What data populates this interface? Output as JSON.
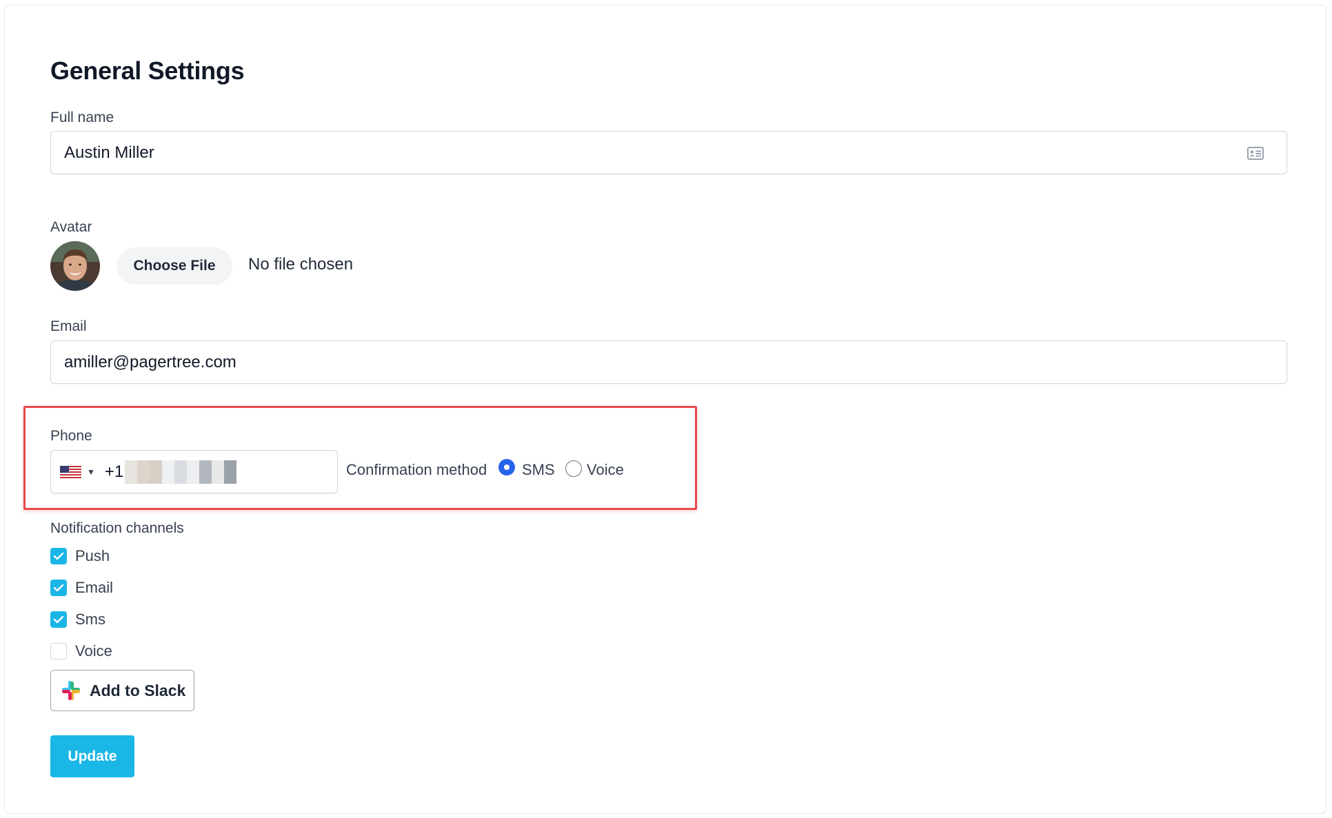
{
  "page": {
    "title": "General Settings"
  },
  "full_name": {
    "label": "Full name",
    "value": "Austin Miller",
    "icon": "id-card-icon"
  },
  "avatar": {
    "label": "Avatar",
    "choose_file_label": "Choose File",
    "file_status": "No file chosen"
  },
  "email": {
    "label": "Email",
    "value": "amiller@pagertree.com"
  },
  "phone": {
    "label": "Phone",
    "country_flag": "us-flag-icon",
    "prefix": "+1",
    "confirmation_label": "Confirmation method",
    "options": [
      {
        "label": "SMS",
        "selected": true
      },
      {
        "label": "Voice",
        "selected": false
      }
    ]
  },
  "notifications": {
    "label": "Notification channels",
    "channels": [
      {
        "label": "Push",
        "checked": true
      },
      {
        "label": "Email",
        "checked": true
      },
      {
        "label": "Sms",
        "checked": true
      },
      {
        "label": "Voice",
        "checked": false
      }
    ]
  },
  "slack": {
    "label": "Add to Slack"
  },
  "actions": {
    "update_label": "Update"
  },
  "colors": {
    "accent": "#1ab6e6",
    "radio_selected": "#2563eb",
    "highlight": "#e5484d"
  }
}
